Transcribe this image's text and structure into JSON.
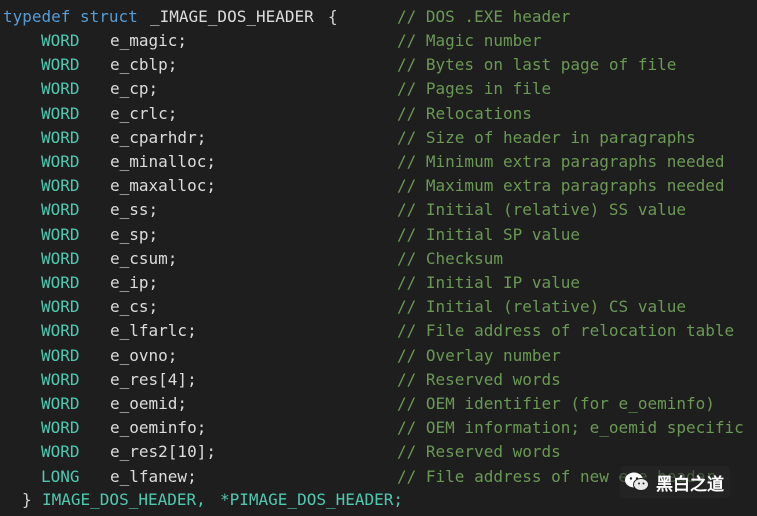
{
  "code": {
    "header": {
      "kw_typedef": "typedef",
      "kw_struct": "struct",
      "name": "_IMAGE_DOS_HEADER",
      "brace": "{",
      "comment": "// DOS .EXE header"
    },
    "fields": [
      {
        "type": "WORD",
        "name": "e_magic;",
        "comment": "// Magic number"
      },
      {
        "type": "WORD",
        "name": "e_cblp;",
        "comment": "// Bytes on last page of file"
      },
      {
        "type": "WORD",
        "name": "e_cp;",
        "comment": "// Pages in file"
      },
      {
        "type": "WORD",
        "name": "e_crlc;",
        "comment": "// Relocations"
      },
      {
        "type": "WORD",
        "name": "e_cparhdr;",
        "comment": "// Size of header in paragraphs"
      },
      {
        "type": "WORD",
        "name": "e_minalloc;",
        "comment": "// Minimum extra paragraphs needed"
      },
      {
        "type": "WORD",
        "name": "e_maxalloc;",
        "comment": "// Maximum extra paragraphs needed"
      },
      {
        "type": "WORD",
        "name": "e_ss;",
        "comment": "// Initial (relative) SS value"
      },
      {
        "type": "WORD",
        "name": "e_sp;",
        "comment": "// Initial SP value"
      },
      {
        "type": "WORD",
        "name": "e_csum;",
        "comment": "// Checksum"
      },
      {
        "type": "WORD",
        "name": "e_ip;",
        "comment": "// Initial IP value"
      },
      {
        "type": "WORD",
        "name": "e_cs;",
        "comment": "// Initial (relative) CS value"
      },
      {
        "type": "WORD",
        "name": "e_lfarlc;",
        "comment": "// File address of relocation table"
      },
      {
        "type": "WORD",
        "name": "e_ovno;",
        "comment": "// Overlay number"
      },
      {
        "type": "WORD",
        "name": "e_res[4];",
        "comment": "// Reserved words"
      },
      {
        "type": "WORD",
        "name": "e_oemid;",
        "comment": "// OEM identifier (for e_oeminfo)"
      },
      {
        "type": "WORD",
        "name": "e_oeminfo;",
        "comment": "// OEM information; e_oemid specific"
      },
      {
        "type": "WORD",
        "name": "e_res2[10];",
        "comment": "// Reserved words"
      },
      {
        "type": "LONG",
        "name": "e_lfanew;",
        "comment": "// File address of new exe header"
      }
    ],
    "footer": {
      "brace": "}",
      "type_name": "IMAGE_DOS_HEADER,",
      "ptr_name": "*PIMAGE_DOS_HEADER;"
    }
  },
  "watermark": {
    "text": "黑白之道",
    "icon": "wechat-icon"
  },
  "colors": {
    "background": "#1e1e1e",
    "keyword": "#569cd6",
    "type": "#4ec9b0",
    "identifier": "#dcdcdc",
    "comment": "#6a9955"
  }
}
